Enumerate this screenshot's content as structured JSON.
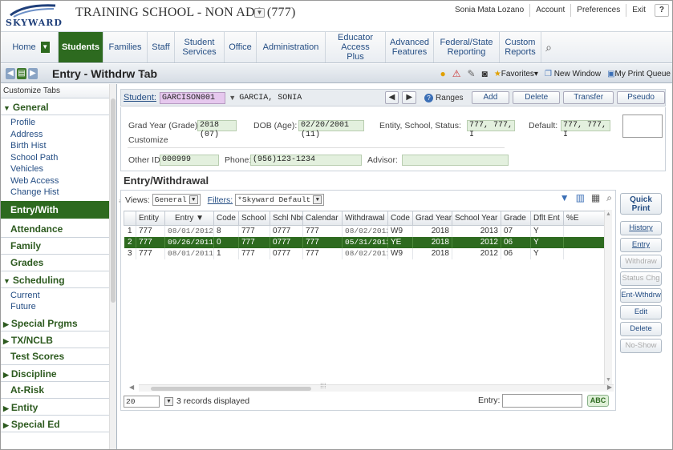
{
  "header": {
    "logo_text": "SKYWARD",
    "school_name": "TRAINING SCHOOL - NON ADA (777)",
    "user_name": "Sonia Mata Lozano",
    "links": [
      "Account",
      "Preferences",
      "Exit"
    ],
    "help_label": "?"
  },
  "nav": {
    "tabs": [
      "Home",
      "Students",
      "Families",
      "Staff",
      "Student Services",
      "Office",
      "Administration",
      "Educator Access Plus",
      "Advanced Features",
      "Federal/State Reporting",
      "Custom Reports"
    ],
    "active_tab": "Students"
  },
  "titlebar": {
    "title": "Entry - Withdrw Tab",
    "favorites_label": "Favorites",
    "new_window_label": "New Window",
    "print_queue_label": "My Print Queue"
  },
  "sidebar": {
    "header": "Customize Tabs",
    "general_label": "General",
    "general_items": [
      "Profile",
      "Address",
      "Birth Hist",
      "School Path",
      "Vehicles",
      "Web Access",
      "Change Hist"
    ],
    "active_item": "Entry/With",
    "sections_after": [
      "Attendance",
      "Family",
      "Grades"
    ],
    "scheduling_label": "Scheduling",
    "scheduling_items": [
      "Current",
      "Future"
    ],
    "collapsed_1": "Special Prgms",
    "collapsed_2": "TX/NCLB",
    "plain_1": "Test Scores",
    "collapsed_3": "Discipline",
    "plain_2": "At-Risk",
    "collapsed_4": "Entity",
    "collapsed_5": "Special Ed"
  },
  "studentbar": {
    "label": "Student:",
    "student_id": "GARCISON001",
    "student_name": "GARCIA, SONIA",
    "ranges_label": "Ranges",
    "buttons": [
      "Add",
      "Delete",
      "Transfer",
      "Pseudo"
    ]
  },
  "info": {
    "grad_year_label": "Grad Year (Grade):",
    "grad_year_value": "2018 (07)",
    "dob_label": "DOB (Age):",
    "dob_value": "02/20/2001 (11)",
    "entity_label": "Entity, School, Status:",
    "entity_value": "777, 777, I",
    "default_label": "Default:",
    "default_value": "777, 777, I",
    "customize_label": "Customize",
    "other_id_label": "Other ID:",
    "other_id_value": "000999",
    "phone_label": "Phone:",
    "phone_value": "(956)123-1234",
    "advisor_label": "Advisor:",
    "advisor_value": ""
  },
  "entry_withdrawal": {
    "title": "Entry/Withdrawal",
    "views_label": "Views:",
    "views_value": "General",
    "filters_label": "Filters:",
    "filters_value": "*Skyward Default",
    "columns": [
      "Entity",
      "Entry",
      "Code",
      "School",
      "Schl Nbr",
      "Calendar",
      "Withdrawal",
      "Code",
      "Grad Year",
      "School Year",
      "Grade",
      "Dflt Ent",
      "%E"
    ],
    "rows": [
      [
        "1",
        "777",
        "08/01/2012",
        "8",
        "777",
        "0777",
        "777",
        "08/02/2012",
        "W9",
        "2018",
        "2013",
        "07",
        "Y",
        ""
      ],
      [
        "2",
        "777",
        "09/26/2011",
        "0",
        "777",
        "0777",
        "777",
        "05/31/2012",
        "YE",
        "2018",
        "2012",
        "06",
        "Y",
        ""
      ],
      [
        "3",
        "777",
        "08/01/2011",
        "1",
        "777",
        "0777",
        "777",
        "08/02/2011",
        "W9",
        "2018",
        "2012",
        "06",
        "Y",
        ""
      ]
    ],
    "selected_row": 2,
    "per_page": "20",
    "records_text": "3 records displayed",
    "entry_label": "Entry:",
    "abc_label": "ABC"
  },
  "actions": {
    "quick_print": "Quick Print",
    "history": "History",
    "entry": "Entry",
    "withdraw": "Withdraw",
    "status_chg": "Status Chg",
    "ent_wthdrw": "Ent-Wthdrw",
    "edit": "Edit",
    "delete": "Delete",
    "no_show": "No-Show"
  },
  "colors": {
    "accent_green": "#2d6a1f",
    "link_blue": "#254e84",
    "field_green": "#e3f0de",
    "field_purple": "#e6c8ee"
  }
}
